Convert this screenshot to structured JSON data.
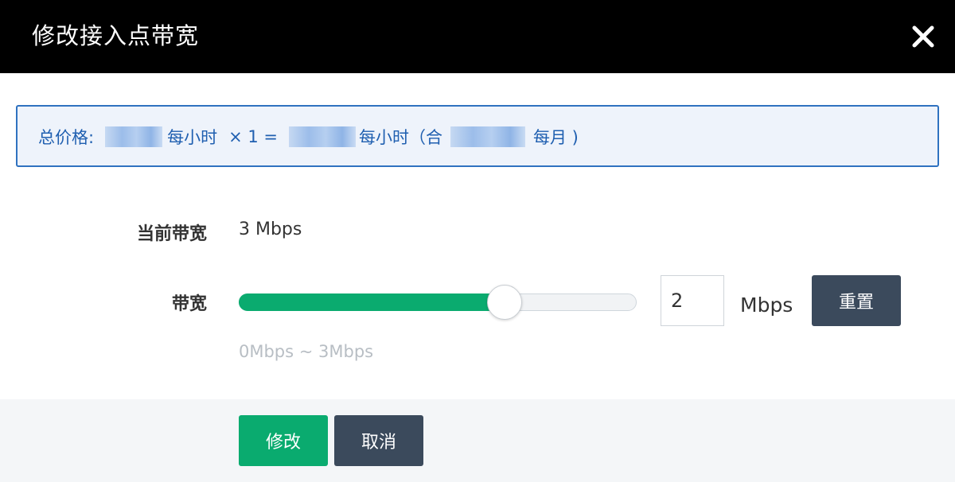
{
  "dialog": {
    "title": "修改接入点带宽",
    "close_icon": "close-icon"
  },
  "price": {
    "label": "总价格:",
    "per_hour_1": "每小时",
    "multiplier": "× 1 =",
    "per_hour_2": "每小时（合",
    "per_month": "每月 )",
    "accent_color": "#2f72c0"
  },
  "current_bandwidth": {
    "label": "当前带宽",
    "value": "3 Mbps"
  },
  "bandwidth": {
    "label": "带宽",
    "slider_fraction": 0.667,
    "input_value": "2",
    "unit": "Mbps",
    "reset_label": "重置",
    "range_hint": "0Mbps ~ 3Mbps",
    "fill_color": "#0aab6f"
  },
  "actions": {
    "confirm_label": "修改",
    "cancel_label": "取消"
  }
}
